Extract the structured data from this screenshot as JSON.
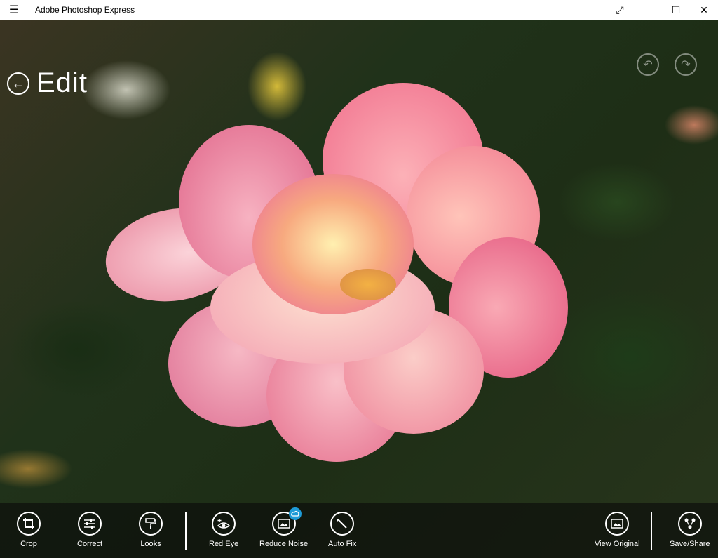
{
  "window": {
    "title": "Adobe Photoshop Express"
  },
  "editor": {
    "heading": "Edit"
  },
  "colors": {
    "badge": "#1e9bd7",
    "toolbar_bg": "#0a0a0a",
    "petal_pink": "#f49ab0"
  },
  "toolbar": {
    "crop": "Crop",
    "correct": "Correct",
    "looks": "Looks",
    "red_eye": "Red Eye",
    "reduce_noise": "Reduce Noise",
    "auto_fix": "Auto Fix",
    "view_original": "View Original",
    "save_share": "Save/Share"
  }
}
